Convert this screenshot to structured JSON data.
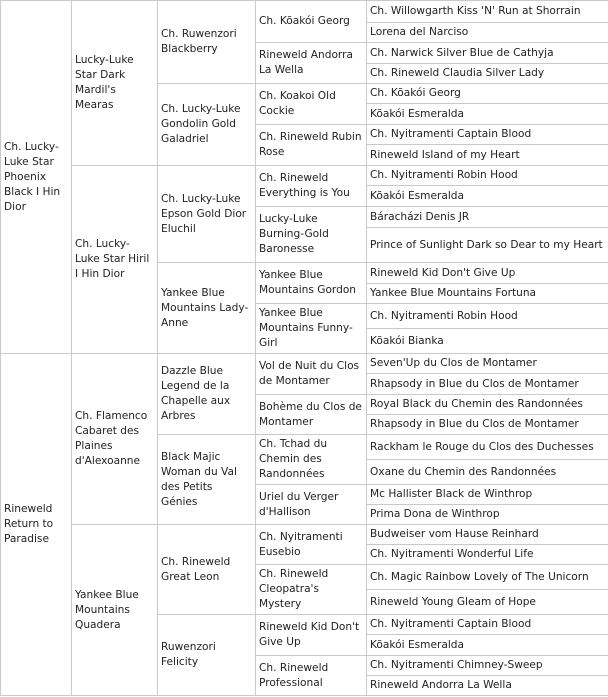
{
  "pedigree": {
    "g1": [
      "Ch. Lucky-Luke Star Phoenix Black I Hin Dior",
      "Rineweld Return to Paradise"
    ],
    "g2": [
      "Lucky-Luke Star Dark Mardil's Mearas",
      "Ch. Lucky-Luke Star Hiril I Hin Dior",
      "Ch. Flamenco Cabaret des Plaines d'Alexoanne",
      "Yankee Blue Mountains Quadera"
    ],
    "g3": [
      "Ch. Ruwenzori Blackberry",
      "Ch. Lucky-Luke Gondolin Gold Galadriel",
      "Ch. Lucky-Luke Epson Gold Dior Eluchil",
      "Yankee Blue Mountains Lady-Anne",
      "Dazzle Blue Legend de la Chapelle aux Arbres",
      "Black Majic Woman du Val des Petits Génies",
      "Ch. Rineweld Great Leon",
      "Ruwenzori Felicity"
    ],
    "g4": [
      "Ch. Kõakói Georg",
      "Rineweld Andorra La Wella",
      "Ch. Koakoi Old Cockie",
      "Ch. Rineweld Rubin Rose",
      "Ch. Rineweld Everything is You",
      "Lucky-Luke Burning-Gold Baronesse",
      "Yankee Blue Mountains Gordon",
      "Yankee Blue Mountains Funny-Girl",
      "Vol de Nuit du Clos de Montamer",
      "Bohème du Clos de Montamer",
      "Ch. Tchad du Chemin des Randonnées",
      "Uriel du Verger d'Hallison",
      "Ch. Nyitramenti Eusebio",
      "Ch. Rineweld Cleopatra's Mystery",
      "Rineweld Kid Don't Give Up",
      "Ch. Rineweld Professional"
    ],
    "g5": [
      "Ch. Willowgarth Kiss 'N' Run at Shorrain",
      "Lorena del Narciso",
      "Ch. Narwick Silver Blue de Cathyja",
      "Ch. Rineweld Claudia Silver Lady",
      "Ch. Kõakói Georg",
      "Kõakói Esmeralda",
      "Ch. Nyitramenti Captain Blood",
      "Rineweld Island of my Heart",
      "Ch. Nyitramenti Robin Hood",
      "Kõakói Esmeralda",
      "Báracházi Denis JR",
      "Prince of Sunlight Dark so Dear to my Heart",
      "Rineweld Kid Don't Give Up",
      "Yankee Blue Mountains Fortuna",
      "Ch. Nyitramenti Robin Hood",
      "Kõakói Bianka",
      "Seven'Up du Clos de Montamer",
      "Rhapsody in Blue du Clos de Montamer",
      "Royal Black du Chemin des Randonnées",
      "Rhapsody in Blue du Clos de Montamer",
      "Rackham le Rouge du Clos des Duchesses",
      "Oxane du Chemin des Randonnées",
      "Mc Hallister Black de Winthrop",
      "Prima Dona de Winthrop",
      "Budweiser vom Hause Reinhard",
      "Ch. Nyitramenti Wonderful Life",
      "Ch. Magic Rainbow Lovely of The Unicorn",
      "Rineweld Young Gleam of Hope",
      "Ch. Nyitramenti Captain Blood",
      "Kõakói Esmeralda",
      "Ch. Nyitramenti Chimney-Sweep",
      "Rineweld Andorra La Wella"
    ]
  },
  "highlight_colors": {
    "light_blue": "#d9ecf8",
    "medium_blue": "#b9dbf4",
    "mint_green": "#d9efdf",
    "yellow_green": "#e6f199",
    "lavender": "#e6e1f1",
    "sage": "#dde7d9"
  }
}
